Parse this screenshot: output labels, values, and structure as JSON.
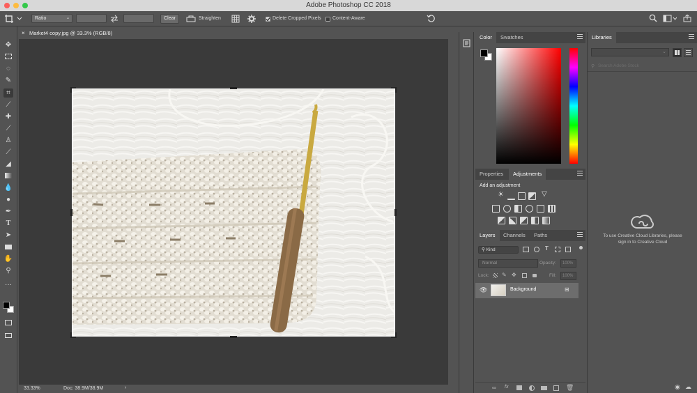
{
  "app": {
    "title": "Adobe Photoshop CC 2018"
  },
  "options_bar": {
    "ratio_select": "Ratio",
    "clear_label": "Clear",
    "straighten_label": "Straighten",
    "delete_cropped_label": "Delete Cropped Pixels",
    "content_aware_label": "Content-Aware",
    "delete_cropped_checked": true,
    "content_aware_checked": false
  },
  "document": {
    "tab_title": "Market4 copy.jpg @ 33.3% (RGB/8)",
    "zoom": "33.33%",
    "doc_info": "Doc: 38.9M/38.9M"
  },
  "color_panel": {
    "tabs": [
      "Color",
      "Swatches"
    ],
    "foreground": "#000000",
    "background": "#ffffff",
    "hue_color": "#ff0000"
  },
  "adjustments_panel": {
    "tabs": [
      "Properties",
      "Adjustments"
    ],
    "heading": "Add an adjustment"
  },
  "layers_panel": {
    "tabs": [
      "Layers",
      "Channels",
      "Paths"
    ],
    "kind_filter": "Kind",
    "blend_mode": "Normal",
    "opacity_label": "Opacity:",
    "opacity_value": "100%",
    "lock_label": "Lock:",
    "fill_label": "Fill:",
    "fill_value": "100%",
    "layers": [
      {
        "name": "Background",
        "visible": true,
        "locked": true
      }
    ]
  },
  "libraries_panel": {
    "title": "Libraries",
    "search_placeholder": "Search Adobe Stock",
    "message": "To use Creative Cloud Libraries, please sign in to Creative Cloud"
  },
  "tools": [
    "move-tool",
    "marquee-tool",
    "lasso-tool",
    "quick-select-tool",
    "crop-tool",
    "eyedropper-tool",
    "healing-tool",
    "brush-tool",
    "clone-stamp-tool",
    "history-brush-tool",
    "eraser-tool",
    "gradient-tool",
    "blur-tool",
    "dodge-tool",
    "pen-tool",
    "type-tool",
    "path-select-tool",
    "rectangle-tool",
    "hand-tool",
    "zoom-tool",
    "more-tools-icon"
  ]
}
